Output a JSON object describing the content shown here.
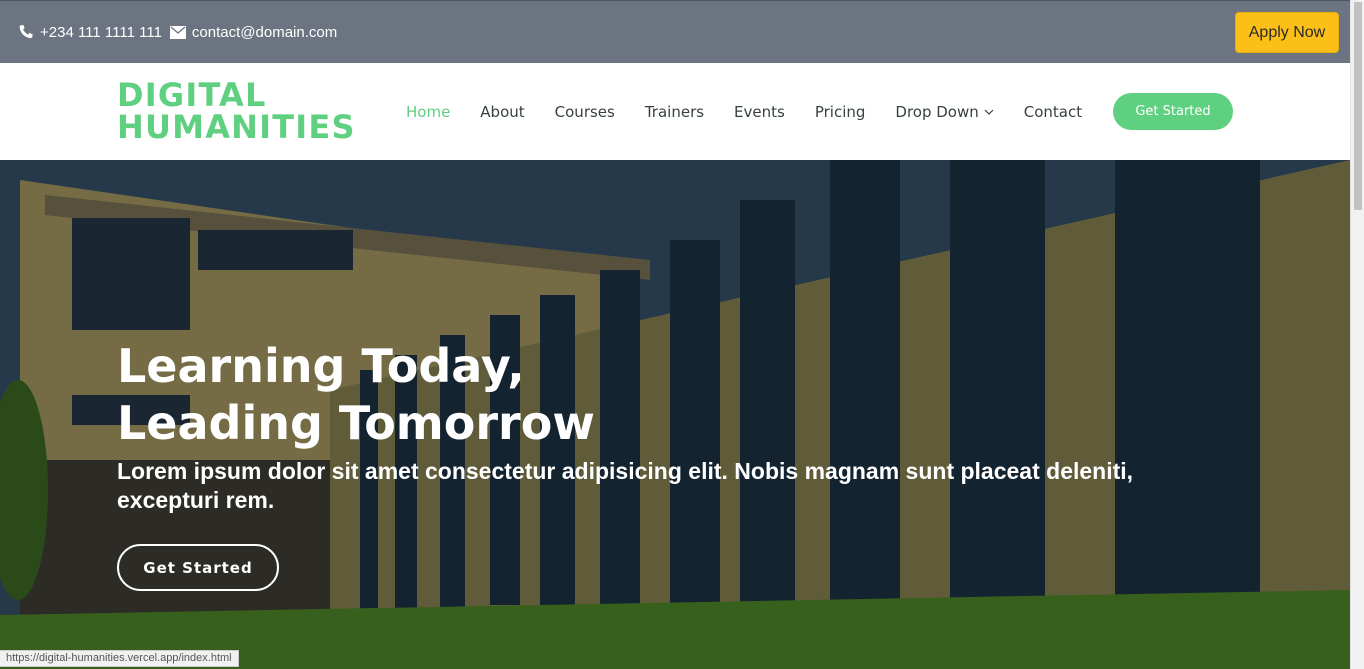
{
  "topbar": {
    "phone": "+234 111 1111 111",
    "email": "contact@domain.com",
    "apply_label": "Apply Now"
  },
  "header": {
    "logo_line1": "DIGITAL",
    "logo_line2": "HUMANITIES",
    "nav": [
      "Home",
      "About",
      "Courses",
      "Trainers",
      "Events",
      "Pricing",
      "Drop Down",
      "Contact"
    ],
    "active": "Home",
    "cta_label": "Get Started"
  },
  "hero": {
    "title_line1": "Learning Today,",
    "title_line2": "Leading Tomorrow",
    "subtitle": "Lorem ipsum dolor sit amet consectetur adipisicing elit. Nobis magnam sunt placeat deleniti, excepturi rem.",
    "button_label": "Get Started"
  },
  "status_url": "https://digital-humanities.vercel.app/index.html",
  "icons": {
    "phone": "phone-icon",
    "email": "envelope-icon",
    "dropdown": "chevron-down-icon"
  },
  "colors": {
    "accent": "#5fcf80",
    "apply": "#fbbf18",
    "topbar": "#6b7480"
  }
}
